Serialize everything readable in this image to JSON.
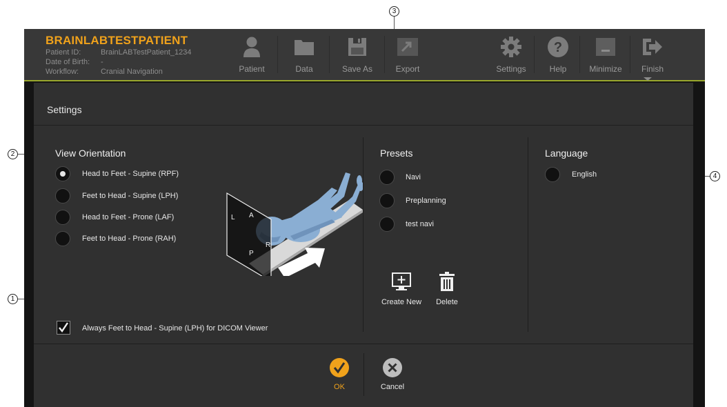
{
  "header": {
    "patient_name": "BRAINLABTESTPATIENT",
    "patient_id_label": "Patient ID:",
    "patient_id": "BrainLABTestPatient_1234",
    "dob_label": "Date of Birth:",
    "dob": "-",
    "workflow_label": "Workflow:",
    "workflow": "Cranial Navigation",
    "accent_color": "#f0a21b",
    "toolbar": [
      {
        "label": "Patient",
        "icon": "person-icon"
      },
      {
        "label": "Data",
        "icon": "folder-icon"
      },
      {
        "label": "Save As",
        "icon": "floppy-disk-icon"
      },
      {
        "label": "Export",
        "icon": "export-icon"
      },
      {
        "label": "Settings",
        "icon": "gear-icon"
      },
      {
        "label": "Help",
        "icon": "help-icon"
      },
      {
        "label": "Minimize",
        "icon": "minimize-icon"
      },
      {
        "label": "Finish",
        "icon": "exit-arrow-icon"
      }
    ]
  },
  "dialog": {
    "title": "Settings",
    "view_orientation": {
      "title": "View Orientation",
      "options": [
        {
          "label": "Head to Feet - Supine (RPF)",
          "selected": true
        },
        {
          "label": "Feet to Head - Supine (LPH)",
          "selected": false
        },
        {
          "label": "Head to Feet - Prone (LAF)",
          "selected": false
        },
        {
          "label": "Feet to Head - Prone (RAH)",
          "selected": false
        }
      ],
      "illustration_letters": [
        "L",
        "A",
        "P",
        "R"
      ],
      "dicom_checkbox_label": "Always Feet to Head - Supine (LPH) for DICOM Viewer",
      "dicom_checked": true
    },
    "presets": {
      "title": "Presets",
      "items": [
        "Navi",
        "Preplanning",
        "test navi"
      ],
      "create_new_label": "Create New",
      "delete_label": "Delete"
    },
    "language": {
      "title": "Language",
      "items": [
        "English"
      ]
    },
    "ok_label": "OK",
    "cancel_label": "Cancel",
    "ok_color": "#f0a21b"
  },
  "callouts": [
    "1",
    "2",
    "3",
    "4"
  ]
}
